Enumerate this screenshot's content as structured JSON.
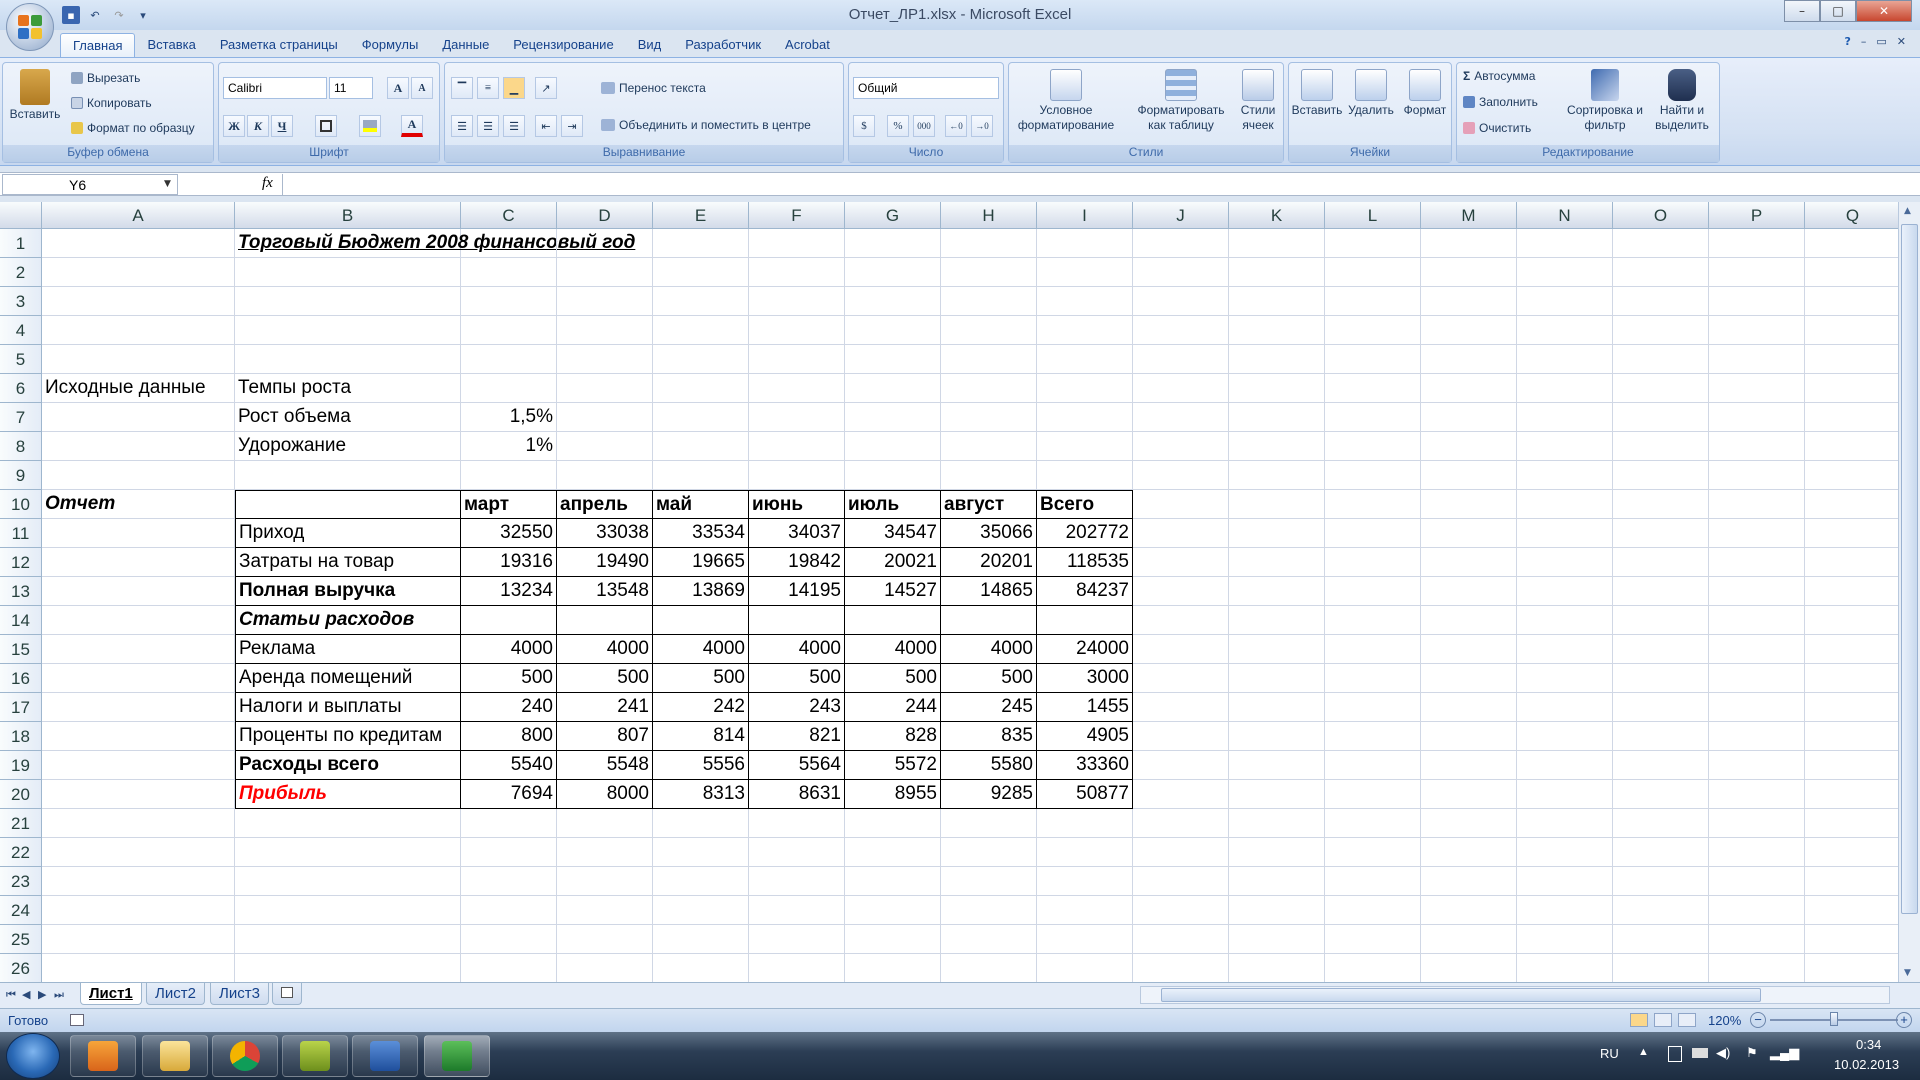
{
  "window": {
    "title": "Отчет_ЛР1.xlsx - Microsoft Excel",
    "controls": [
      "–",
      "□",
      "✕"
    ]
  },
  "tabs": [
    "Главная",
    "Вставка",
    "Разметка страницы",
    "Формулы",
    "Данные",
    "Рецензирование",
    "Вид",
    "Разработчик",
    "Acrobat"
  ],
  "ribbon": {
    "clipboard": {
      "paste": "Вставить",
      "cut": "Вырезать",
      "copy": "Копировать",
      "format_painter": "Формат по образцу",
      "title": "Буфер обмена"
    },
    "font": {
      "name": "Calibri",
      "size": "11",
      "grow": "A",
      "shrink": "A",
      "bold": "Ж",
      "italic": "К",
      "underline": "Ч",
      "color": "A",
      "title": "Шрифт"
    },
    "alignment": {
      "wrap": "Перенос текста",
      "merge": "Объединить и поместить в центре",
      "title": "Выравнивание"
    },
    "number": {
      "format": "Общий",
      "percent": "%",
      "thousands": "000",
      "title": "Число"
    },
    "styles": {
      "conditional": "Условное форматирование",
      "as_table": "Форматировать как таблицу",
      "cell_styles": "Стили ячеек",
      "title": "Стили"
    },
    "cells": {
      "insert": "Вставить",
      "delete": "Удалить",
      "format": "Формат",
      "title": "Ячейки"
    },
    "editing": {
      "autosum": "Автосумма",
      "fill": "Заполнить",
      "clear": "Очистить",
      "sort": "Сортировка и фильтр",
      "find": "Найти и выделить",
      "title": "Редактирование"
    }
  },
  "formula_bar": {
    "name_box": "Y6",
    "fx": "fx",
    "value": ""
  },
  "columns": [
    "A",
    "B",
    "C",
    "D",
    "E",
    "F",
    "G",
    "H",
    "I",
    "J",
    "K",
    "L",
    "M",
    "N",
    "O",
    "P",
    "Q"
  ],
  "rows": [
    {
      "n": "1",
      "cells": [
        "",
        "Торговый Бюджет 2008 финансовый год",
        "",
        "",
        "",
        "",
        "",
        "",
        ""
      ]
    },
    {
      "n": "2",
      "cells": [
        "",
        "",
        "",
        "",
        "",
        "",
        "",
        "",
        ""
      ]
    },
    {
      "n": "3",
      "cells": [
        "",
        "",
        "",
        "",
        "",
        "",
        "",
        "",
        ""
      ]
    },
    {
      "n": "4",
      "cells": [
        "",
        "",
        "",
        "",
        "",
        "",
        "",
        "",
        ""
      ]
    },
    {
      "n": "5",
      "cells": [
        "",
        "",
        "",
        "",
        "",
        "",
        "",
        "",
        ""
      ]
    },
    {
      "n": "6",
      "cells": [
        "Исходные данные",
        "Темпы роста",
        "",
        "",
        "",
        "",
        "",
        "",
        ""
      ]
    },
    {
      "n": "7",
      "cells": [
        "",
        "Рост объема",
        "1,5%",
        "",
        "",
        "",
        "",
        "",
        ""
      ]
    },
    {
      "n": "8",
      "cells": [
        "",
        "Удорожание",
        "1%",
        "",
        "",
        "",
        "",
        "",
        ""
      ]
    },
    {
      "n": "9",
      "cells": [
        "",
        "",
        "",
        "",
        "",
        "",
        "",
        "",
        ""
      ]
    },
    {
      "n": "10",
      "cells": [
        "Отчет",
        "",
        "март",
        "апрель",
        "май",
        "июнь",
        "июль",
        "август",
        "Всего"
      ]
    },
    {
      "n": "11",
      "cells": [
        "",
        "Приход",
        "32550",
        "33038",
        "33534",
        "34037",
        "34547",
        "35066",
        "202772"
      ]
    },
    {
      "n": "12",
      "cells": [
        "",
        "Затраты на товар",
        "19316",
        "19490",
        "19665",
        "19842",
        "20021",
        "20201",
        "118535"
      ]
    },
    {
      "n": "13",
      "cells": [
        "",
        "Полная выручка",
        "13234",
        "13548",
        "13869",
        "14195",
        "14527",
        "14865",
        "84237"
      ]
    },
    {
      "n": "14",
      "cells": [
        "",
        "Статьи расходов",
        "",
        "",
        "",
        "",
        "",
        "",
        ""
      ]
    },
    {
      "n": "15",
      "cells": [
        "",
        "Реклама",
        "4000",
        "4000",
        "4000",
        "4000",
        "4000",
        "4000",
        "24000"
      ]
    },
    {
      "n": "16",
      "cells": [
        "",
        "Аренда помещений",
        "500",
        "500",
        "500",
        "500",
        "500",
        "500",
        "3000"
      ]
    },
    {
      "n": "17",
      "cells": [
        "",
        "Налоги и выплаты",
        "240",
        "241",
        "242",
        "243",
        "244",
        "245",
        "1455"
      ]
    },
    {
      "n": "18",
      "cells": [
        "",
        "Проценты по кредитам",
        "800",
        "807",
        "814",
        "821",
        "828",
        "835",
        "4905"
      ]
    },
    {
      "n": "19",
      "cells": [
        "",
        "Расходы всего",
        "5540",
        "5548",
        "5556",
        "5564",
        "5572",
        "5580",
        "33360"
      ]
    },
    {
      "n": "20",
      "cells": [
        "",
        "Прибыль",
        "7694",
        "8000",
        "8313",
        "8631",
        "8955",
        "9285",
        "50877"
      ]
    },
    {
      "n": "21",
      "cells": [
        "",
        "",
        "",
        "",
        "",
        "",
        "",
        "",
        ""
      ]
    },
    {
      "n": "22",
      "cells": [
        "",
        "",
        "",
        "",
        "",
        "",
        "",
        "",
        ""
      ]
    },
    {
      "n": "23",
      "cells": [
        "",
        "",
        "",
        "",
        "",
        "",
        "",
        "",
        ""
      ]
    },
    {
      "n": "24",
      "cells": [
        "",
        "",
        "",
        "",
        "",
        "",
        "",
        "",
        ""
      ]
    },
    {
      "n": "25",
      "cells": [
        "",
        "",
        "",
        "",
        "",
        "",
        "",
        "",
        ""
      ]
    },
    {
      "n": "26",
      "cells": [
        "",
        "",
        "",
        "",
        "",
        "",
        "",
        "",
        ""
      ]
    }
  ],
  "sheets": [
    "Лист1",
    "Лист2",
    "Лист3"
  ],
  "status": {
    "ready": "Готово",
    "zoom": "120%"
  },
  "taskbar": {
    "lang": "RU",
    "time": "0:34",
    "date": "10.02.2013"
  },
  "colors": {
    "accent": "#15428b",
    "profit": "#ff0000"
  }
}
